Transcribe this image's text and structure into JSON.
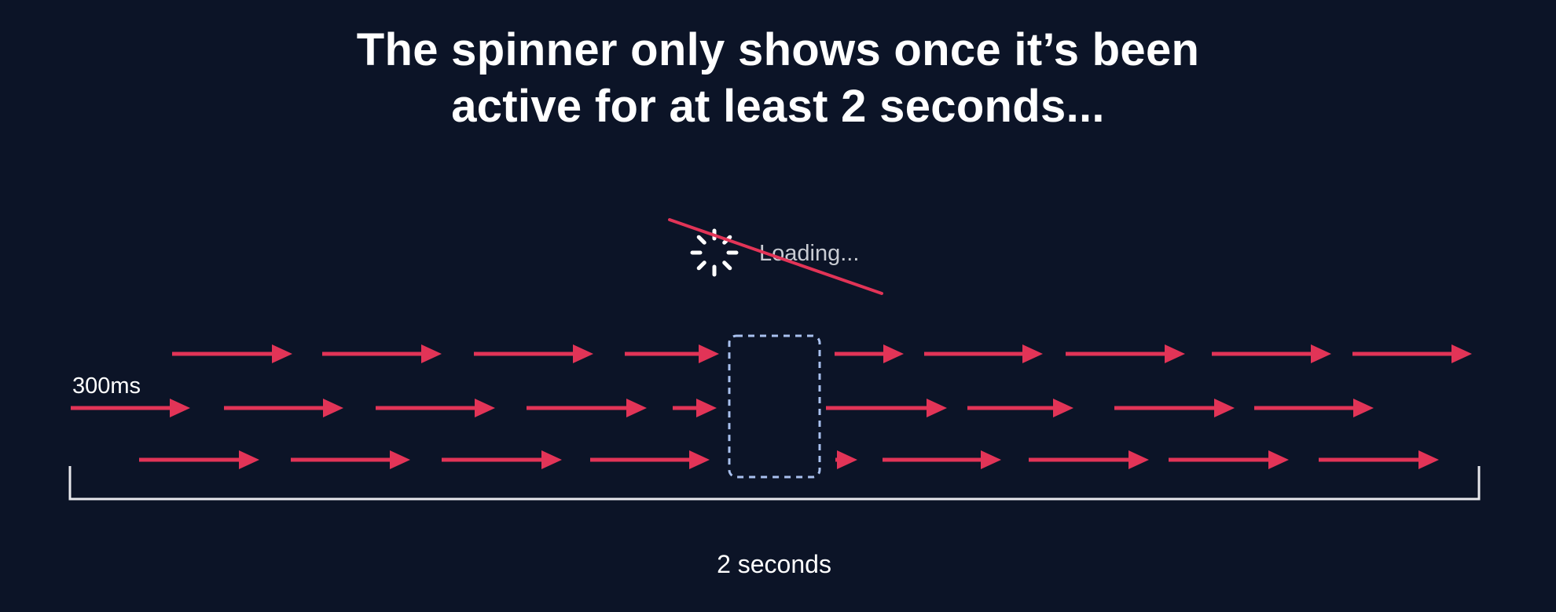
{
  "title": {
    "line1": "The spinner only shows once it’s been",
    "line2": "active for at least 2 seconds..."
  },
  "spinner": {
    "label": "Loading...",
    "icon": "spinner-icon",
    "crossed_out": true
  },
  "labels": {
    "first_request": "300ms",
    "duration": "2 seconds"
  },
  "colors": {
    "background": "#0c1427",
    "arrow": "#e23457",
    "dashed_box": "#a9c1ef",
    "text": "#ffffff",
    "muted_text": "#c9ccd3",
    "bracket": "#e8e8ec"
  }
}
